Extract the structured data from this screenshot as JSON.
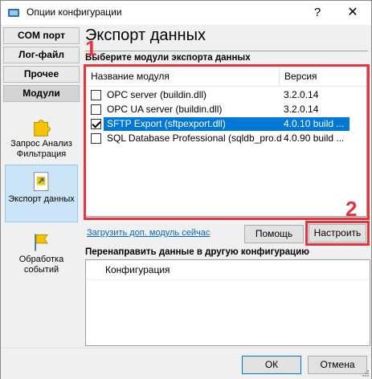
{
  "window": {
    "title": "Опции конфигурации",
    "help_label": "?",
    "close_label": "✕"
  },
  "sidebar": {
    "categories": [
      {
        "label": "COM порт"
      },
      {
        "label": "Лог-файл"
      },
      {
        "label": "Прочее"
      },
      {
        "label": "Модули"
      }
    ],
    "items": [
      {
        "label": "Запрос Анализ Фильтрация",
        "icon": "puzzle-icon"
      },
      {
        "label": "Экспорт данных",
        "icon": "export-icon"
      },
      {
        "label": "Обработка событий",
        "icon": "flag-icon"
      }
    ]
  },
  "main": {
    "heading": "Экспорт данных",
    "modules_label": "Выберите модули экспорта данных",
    "columns": [
      "Название модуля",
      "Версия"
    ],
    "modules": [
      {
        "name": "OPC server (buildin.dll)",
        "version": "3.2.0.14",
        "checked": false,
        "selected": false
      },
      {
        "name": "OPC UA server (buildin.dll)",
        "version": "3.2.0.14",
        "checked": false,
        "selected": false
      },
      {
        "name": "SFTP Export (sftpexport.dll)",
        "version": "4.0.10 build ...",
        "checked": true,
        "selected": true
      },
      {
        "name": "SQL Database Professional (sqldb_pro.dll)",
        "version": "4.0.90 build ...",
        "checked": false,
        "selected": false
      }
    ],
    "load_link": "Загрузить доп. модуль сейчас",
    "help_button": "Помощь",
    "configure_button": "Настроить",
    "redirect_label": "Перенаправить данные в другую конфигурацию",
    "config_column": "Конфигурация",
    "annotation_1": "1",
    "annotation_2": "2",
    "accent_color": "#e8323c",
    "selection_color": "#0078d7"
  },
  "footer": {
    "ok_button": "ОК",
    "cancel_button": "Отмена"
  }
}
